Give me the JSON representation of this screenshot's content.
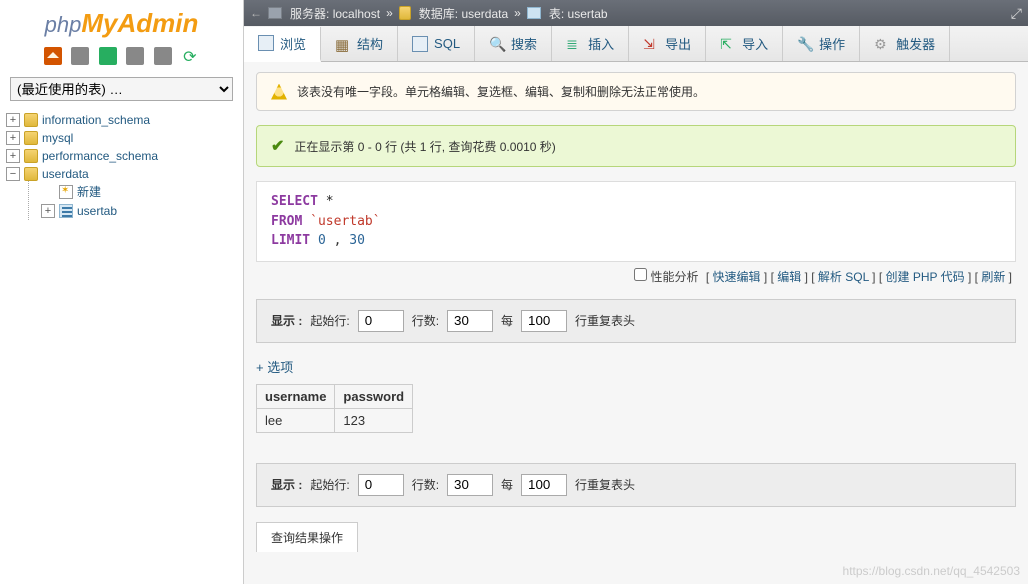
{
  "logo": {
    "php": "php",
    "my": "My",
    "admin": "Admin"
  },
  "sidebar": {
    "recent_placeholder": "(最近使用的表) …",
    "dbs": [
      {
        "name": "information_schema",
        "exp": "+"
      },
      {
        "name": "mysql",
        "exp": "+"
      },
      {
        "name": "performance_schema",
        "exp": "+"
      },
      {
        "name": "userdata",
        "exp": "−"
      }
    ],
    "new_label": "新建",
    "table": {
      "name": "usertab",
      "exp": "+"
    }
  },
  "breadcrumb": {
    "server_lbl": "服务器:",
    "server": "localhost",
    "db_lbl": "数据库:",
    "db": "userdata",
    "tbl_lbl": "表:",
    "tbl": "usertab",
    "sep": "»"
  },
  "tabs": [
    {
      "label": "浏览"
    },
    {
      "label": "结构"
    },
    {
      "label": "SQL"
    },
    {
      "label": "搜索"
    },
    {
      "label": "插入"
    },
    {
      "label": "导出"
    },
    {
      "label": "导入"
    },
    {
      "label": "操作"
    },
    {
      "label": "触发器"
    }
  ],
  "warning": "该表没有唯一字段。单元格编辑、复选框、编辑、复制和删除无法正常使用。",
  "success": "正在显示第 0 - 0 行 (共 1 行, 查询花费 0.0010 秒)",
  "sql": {
    "select": "SELECT",
    "star": "*",
    "from": "FROM",
    "table": "`usertab`",
    "limit": "LIMIT",
    "lim_a": "0",
    "comma": ",",
    "lim_b": "30"
  },
  "sqlops": {
    "profile": "性能分析",
    "links": [
      "快速编辑",
      "编辑",
      "解析 SQL",
      "创建 PHP 代码",
      "刷新"
    ]
  },
  "nav": {
    "show": "显示 :",
    "start": "起始行:",
    "start_v": "0",
    "rows": "行数:",
    "rows_v": "30",
    "each": "每",
    "each_v": "100",
    "repeat": "行重复表头"
  },
  "options_toggle": "+ 选项",
  "chart_data": {
    "type": "table",
    "columns": [
      "username",
      "password"
    ],
    "rows": [
      [
        "lee",
        "123"
      ]
    ]
  },
  "resultops": "查询结果操作",
  "watermark": "https://blog.csdn.net/qq_4542503"
}
